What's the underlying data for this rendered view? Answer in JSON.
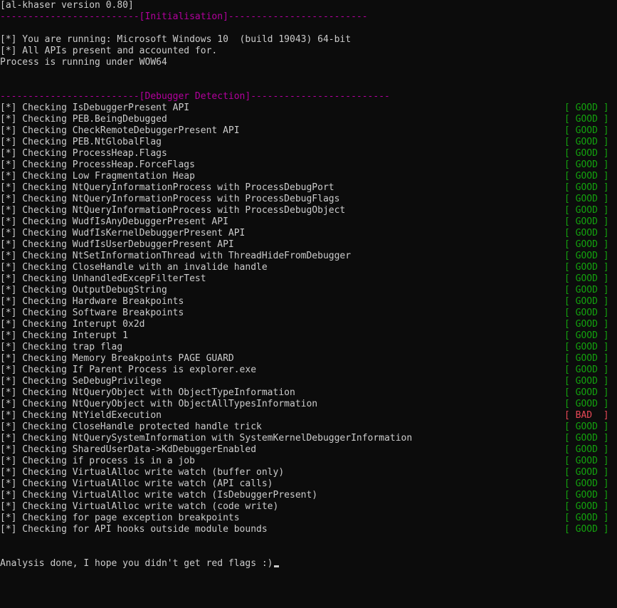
{
  "console": {
    "header": "[al-khaser version 0.80]",
    "init_divider": "-------------------------[Initialisation]-------------------------",
    "init_lines": [
      "[*] You are running: Microsoft Windows 10  (build 19043) 64-bit",
      "[*] All APIs present and accounted for.",
      "Process is running under WOW64"
    ],
    "debugger_divider": "-------------------------[Debugger Detection]-------------------------",
    "checks": [
      {
        "text": "[*] Checking IsDebuggerPresent API",
        "status": "[ GOOD ]",
        "result": "good"
      },
      {
        "text": "[*] Checking PEB.BeingDebugged",
        "status": "[ GOOD ]",
        "result": "good"
      },
      {
        "text": "[*] Checking CheckRemoteDebuggerPresent API",
        "status": "[ GOOD ]",
        "result": "good"
      },
      {
        "text": "[*] Checking PEB.NtGlobalFlag",
        "status": "[ GOOD ]",
        "result": "good"
      },
      {
        "text": "[*] Checking ProcessHeap.Flags",
        "status": "[ GOOD ]",
        "result": "good"
      },
      {
        "text": "[*] Checking ProcessHeap.ForceFlags",
        "status": "[ GOOD ]",
        "result": "good"
      },
      {
        "text": "[*] Checking Low Fragmentation Heap",
        "status": "[ GOOD ]",
        "result": "good"
      },
      {
        "text": "[*] Checking NtQueryInformationProcess with ProcessDebugPort",
        "status": "[ GOOD ]",
        "result": "good"
      },
      {
        "text": "[*] Checking NtQueryInformationProcess with ProcessDebugFlags",
        "status": "[ GOOD ]",
        "result": "good"
      },
      {
        "text": "[*] Checking NtQueryInformationProcess with ProcessDebugObject",
        "status": "[ GOOD ]",
        "result": "good"
      },
      {
        "text": "[*] Checking WudfIsAnyDebuggerPresent API",
        "status": "[ GOOD ]",
        "result": "good"
      },
      {
        "text": "[*] Checking WudfIsKernelDebuggerPresent API",
        "status": "[ GOOD ]",
        "result": "good"
      },
      {
        "text": "[*] Checking WudfIsUserDebuggerPresent API",
        "status": "[ GOOD ]",
        "result": "good"
      },
      {
        "text": "[*] Checking NtSetInformationThread with ThreadHideFromDebugger",
        "status": "[ GOOD ]",
        "result": "good"
      },
      {
        "text": "[*] Checking CloseHandle with an invalide handle",
        "status": "[ GOOD ]",
        "result": "good"
      },
      {
        "text": "[*] Checking UnhandledExcepFilterTest",
        "status": "[ GOOD ]",
        "result": "good"
      },
      {
        "text": "[*] Checking OutputDebugString",
        "status": "[ GOOD ]",
        "result": "good"
      },
      {
        "text": "[*] Checking Hardware Breakpoints",
        "status": "[ GOOD ]",
        "result": "good"
      },
      {
        "text": "[*] Checking Software Breakpoints",
        "status": "[ GOOD ]",
        "result": "good"
      },
      {
        "text": "[*] Checking Interupt 0x2d",
        "status": "[ GOOD ]",
        "result": "good"
      },
      {
        "text": "[*] Checking Interupt 1",
        "status": "[ GOOD ]",
        "result": "good"
      },
      {
        "text": "[*] Checking trap flag",
        "status": "[ GOOD ]",
        "result": "good"
      },
      {
        "text": "[*] Checking Memory Breakpoints PAGE GUARD",
        "status": "[ GOOD ]",
        "result": "good"
      },
      {
        "text": "[*] Checking If Parent Process is explorer.exe",
        "status": "[ GOOD ]",
        "result": "good"
      },
      {
        "text": "[*] Checking SeDebugPrivilege",
        "status": "[ GOOD ]",
        "result": "good"
      },
      {
        "text": "[*] Checking NtQueryObject with ObjectTypeInformation",
        "status": "[ GOOD ]",
        "result": "good"
      },
      {
        "text": "[*] Checking NtQueryObject with ObjectAllTypesInformation",
        "status": "[ GOOD ]",
        "result": "good"
      },
      {
        "text": "[*] Checking NtYieldExecution",
        "status": "[ BAD  ]",
        "result": "bad"
      },
      {
        "text": "[*] Checking CloseHandle protected handle trick",
        "status": "[ GOOD ]",
        "result": "good"
      },
      {
        "text": "[*] Checking NtQuerySystemInformation with SystemKernelDebuggerInformation",
        "status": "[ GOOD ]",
        "result": "good"
      },
      {
        "text": "[*] Checking SharedUserData->KdDebuggerEnabled",
        "status": "[ GOOD ]",
        "result": "good"
      },
      {
        "text": "[*] Checking if process is in a job",
        "status": "[ GOOD ]",
        "result": "good"
      },
      {
        "text": "[*] Checking VirtualAlloc write watch (buffer only)",
        "status": "[ GOOD ]",
        "result": "good"
      },
      {
        "text": "[*] Checking VirtualAlloc write watch (API calls)",
        "status": "[ GOOD ]",
        "result": "good"
      },
      {
        "text": "[*] Checking VirtualAlloc write watch (IsDebuggerPresent)",
        "status": "[ GOOD ]",
        "result": "good"
      },
      {
        "text": "[*] Checking VirtualAlloc write watch (code write)",
        "status": "[ GOOD ]",
        "result": "good"
      },
      {
        "text": "[*] Checking for page exception breakpoints",
        "status": "[ GOOD ]",
        "result": "good"
      },
      {
        "text": "[*] Checking for API hooks outside module bounds",
        "status": "[ GOOD ]",
        "result": "good"
      }
    ],
    "footer": "Analysis done, I hope you didn't get red flags :)"
  },
  "colors": {
    "background": "#0c0c0c",
    "text": "#cccccc",
    "section": "#b4009e",
    "good": "#13a10e",
    "bad": "#e74856"
  }
}
